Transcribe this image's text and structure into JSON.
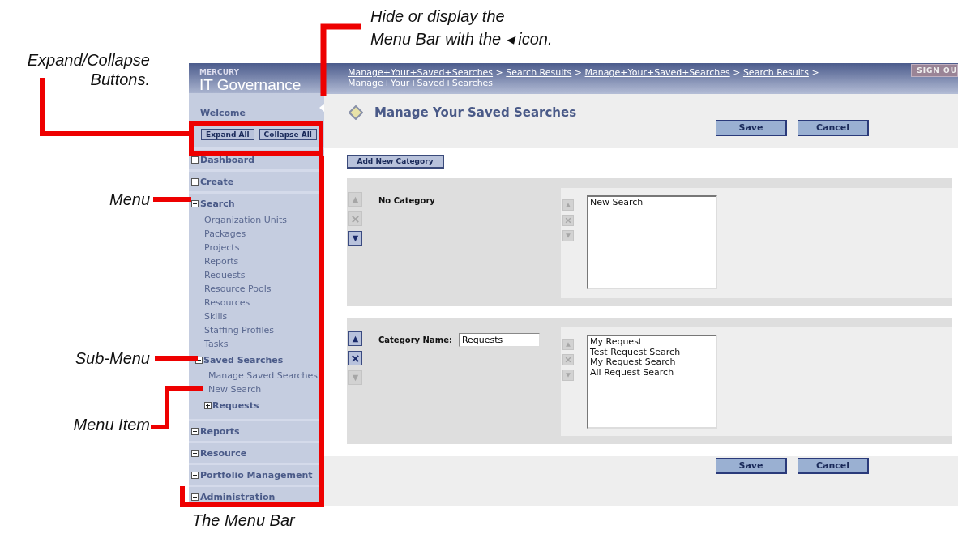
{
  "annotations": {
    "top": "Hide or display the\nMenu Bar with the ◂ icon.",
    "side": [
      {
        "text": "Expand/Collapse Buttons."
      },
      {
        "text": "Menu"
      },
      {
        "text": "Sub-Menu"
      },
      {
        "text": "Menu Item"
      }
    ],
    "bottom": "The Menu Bar"
  },
  "sidebar": {
    "brand_small": "MERCURY",
    "brand": "IT Governance",
    "welcome": "Welcome",
    "buttons": [
      "Expand All",
      "Collapse All"
    ],
    "menu": [
      {
        "label": "Dashboard",
        "expanded": false
      },
      {
        "label": "Create",
        "expanded": false
      },
      {
        "label": "Search",
        "expanded": true,
        "children": [
          {
            "kind": "item",
            "label": "Organization Units"
          },
          {
            "kind": "item",
            "label": "Packages"
          },
          {
            "kind": "item",
            "label": "Projects"
          },
          {
            "kind": "item",
            "label": "Reports"
          },
          {
            "kind": "item",
            "label": "Requests"
          },
          {
            "kind": "item",
            "label": "Resource Pools"
          },
          {
            "kind": "item",
            "label": "Resources"
          },
          {
            "kind": "item",
            "label": "Skills"
          },
          {
            "kind": "item",
            "label": "Staffing Profiles"
          },
          {
            "kind": "item",
            "label": "Tasks"
          },
          {
            "kind": "group",
            "label": "Saved Searches",
            "expanded": true,
            "children": [
              {
                "kind": "item",
                "label": "Manage Saved Searches"
              },
              {
                "kind": "item",
                "label": "New Search"
              }
            ]
          },
          {
            "kind": "group",
            "label": "Requests",
            "expanded": false
          }
        ]
      },
      {
        "label": "Reports",
        "expanded": false
      },
      {
        "label": "Resource",
        "expanded": false
      },
      {
        "label": "Portfolio Management",
        "expanded": false
      },
      {
        "label": "Administration",
        "expanded": false
      }
    ]
  },
  "breadcrumb": {
    "links": [
      "Manage+Your+Saved+Searches",
      "Search Results",
      "Manage+Your+Saved+Searches",
      "Search Results"
    ],
    "separator": ">",
    "current": "Manage+Your+Saved+Searches"
  },
  "sign_out": "SIGN OU",
  "page": {
    "title": "Manage Your Saved Searches",
    "top_buttons": [
      "Save",
      "Cancel"
    ],
    "add_button": "Add New Category",
    "categories": [
      {
        "kind": "fixed",
        "name": "No Category",
        "controls": [
          {
            "kind": "up",
            "disabled": true
          },
          {
            "kind": "delete",
            "disabled": true
          },
          {
            "kind": "down",
            "disabled": false
          }
        ],
        "list_controls": [
          {
            "kind": "up",
            "disabled": true
          },
          {
            "kind": "delete",
            "disabled": true
          },
          {
            "kind": "down",
            "disabled": true
          }
        ],
        "searches": [
          "New Search"
        ]
      },
      {
        "kind": "editable",
        "label": "Category Name:",
        "value": "Requests",
        "controls": [
          {
            "kind": "up",
            "disabled": false
          },
          {
            "kind": "delete",
            "disabled": false
          },
          {
            "kind": "down",
            "disabled": true
          }
        ],
        "list_controls": [
          {
            "kind": "up",
            "disabled": true
          },
          {
            "kind": "delete",
            "disabled": true
          },
          {
            "kind": "down",
            "disabled": true
          }
        ],
        "searches": [
          "My Request",
          "Test Request Search",
          "My Request Search",
          "All Request Search"
        ]
      }
    ],
    "bottom_buttons": [
      "Save",
      "Cancel"
    ]
  }
}
